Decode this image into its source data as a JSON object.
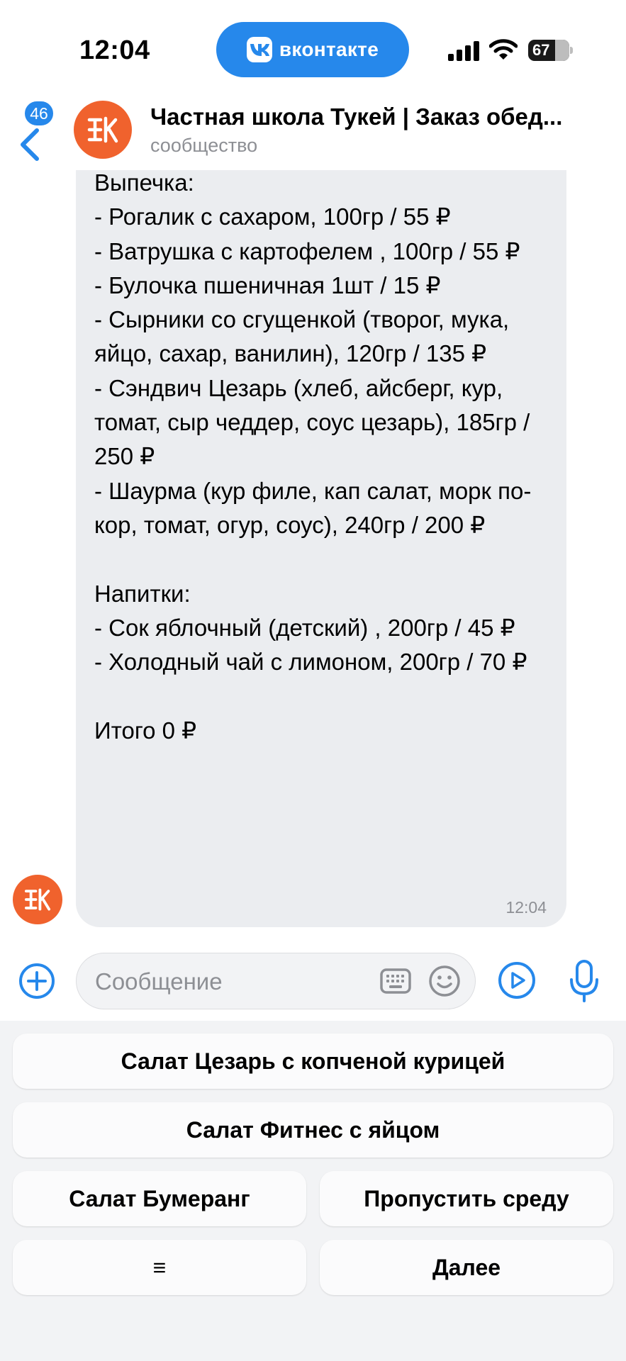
{
  "status_bar": {
    "time": "12:04",
    "app_pill": "вконтакте",
    "battery": "67"
  },
  "header": {
    "unread_count": "46",
    "title": "Частная школа Тукей | Заказ обед...",
    "subtitle": "сообщество",
    "icons": [
      "back-chevron-icon",
      "community-logo-icon"
    ]
  },
  "message": {
    "text": "Выпечка:\n- Рогалик с сахаром, 100гр / 55 ₽\n- Ватрушка с картофелем , 100гр / 55 ₽\n- Булочка пшеничная 1шт / 15 ₽\n- Сырники со сгущенкой (творог, мука, яйцо, сахар, ванилин), 120гр / 135 ₽\n- Сэндвич Цезарь (хлеб, айсберг, кур, томат, сыр чеддер, соус цезарь), 185гр / 250 ₽\n- Шаурма (кур филе, кап салат, морк по-кор, томат, огур, соус), 240гр / 200 ₽\n\nНапитки:\n- Сок яблочный (детский) , 200гр / 45 ₽\n- Холодный чай с лимоном, 200гр / 70 ₽\n\nИтого 0 ₽",
    "time": "12:04"
  },
  "composer": {
    "placeholder": "Сообщение",
    "value": "",
    "icons": [
      "plus-icon",
      "keyboard-icon",
      "smile-icon",
      "play-icon",
      "mic-icon"
    ]
  },
  "bot_keyboard": {
    "row1": "Салат Цезарь с копченой курицей",
    "row2": "Салат Фитнес с яйцом",
    "row3_left": "Салат Бумеранг",
    "row3_right": "Пропустить среду",
    "row4_left": "≡",
    "row4_right": "Далее"
  },
  "colors": {
    "accent": "#2688eb",
    "community_avatar": "#f0622d",
    "bubble": "#ebedf0",
    "secondary_text": "#8d8f94"
  }
}
